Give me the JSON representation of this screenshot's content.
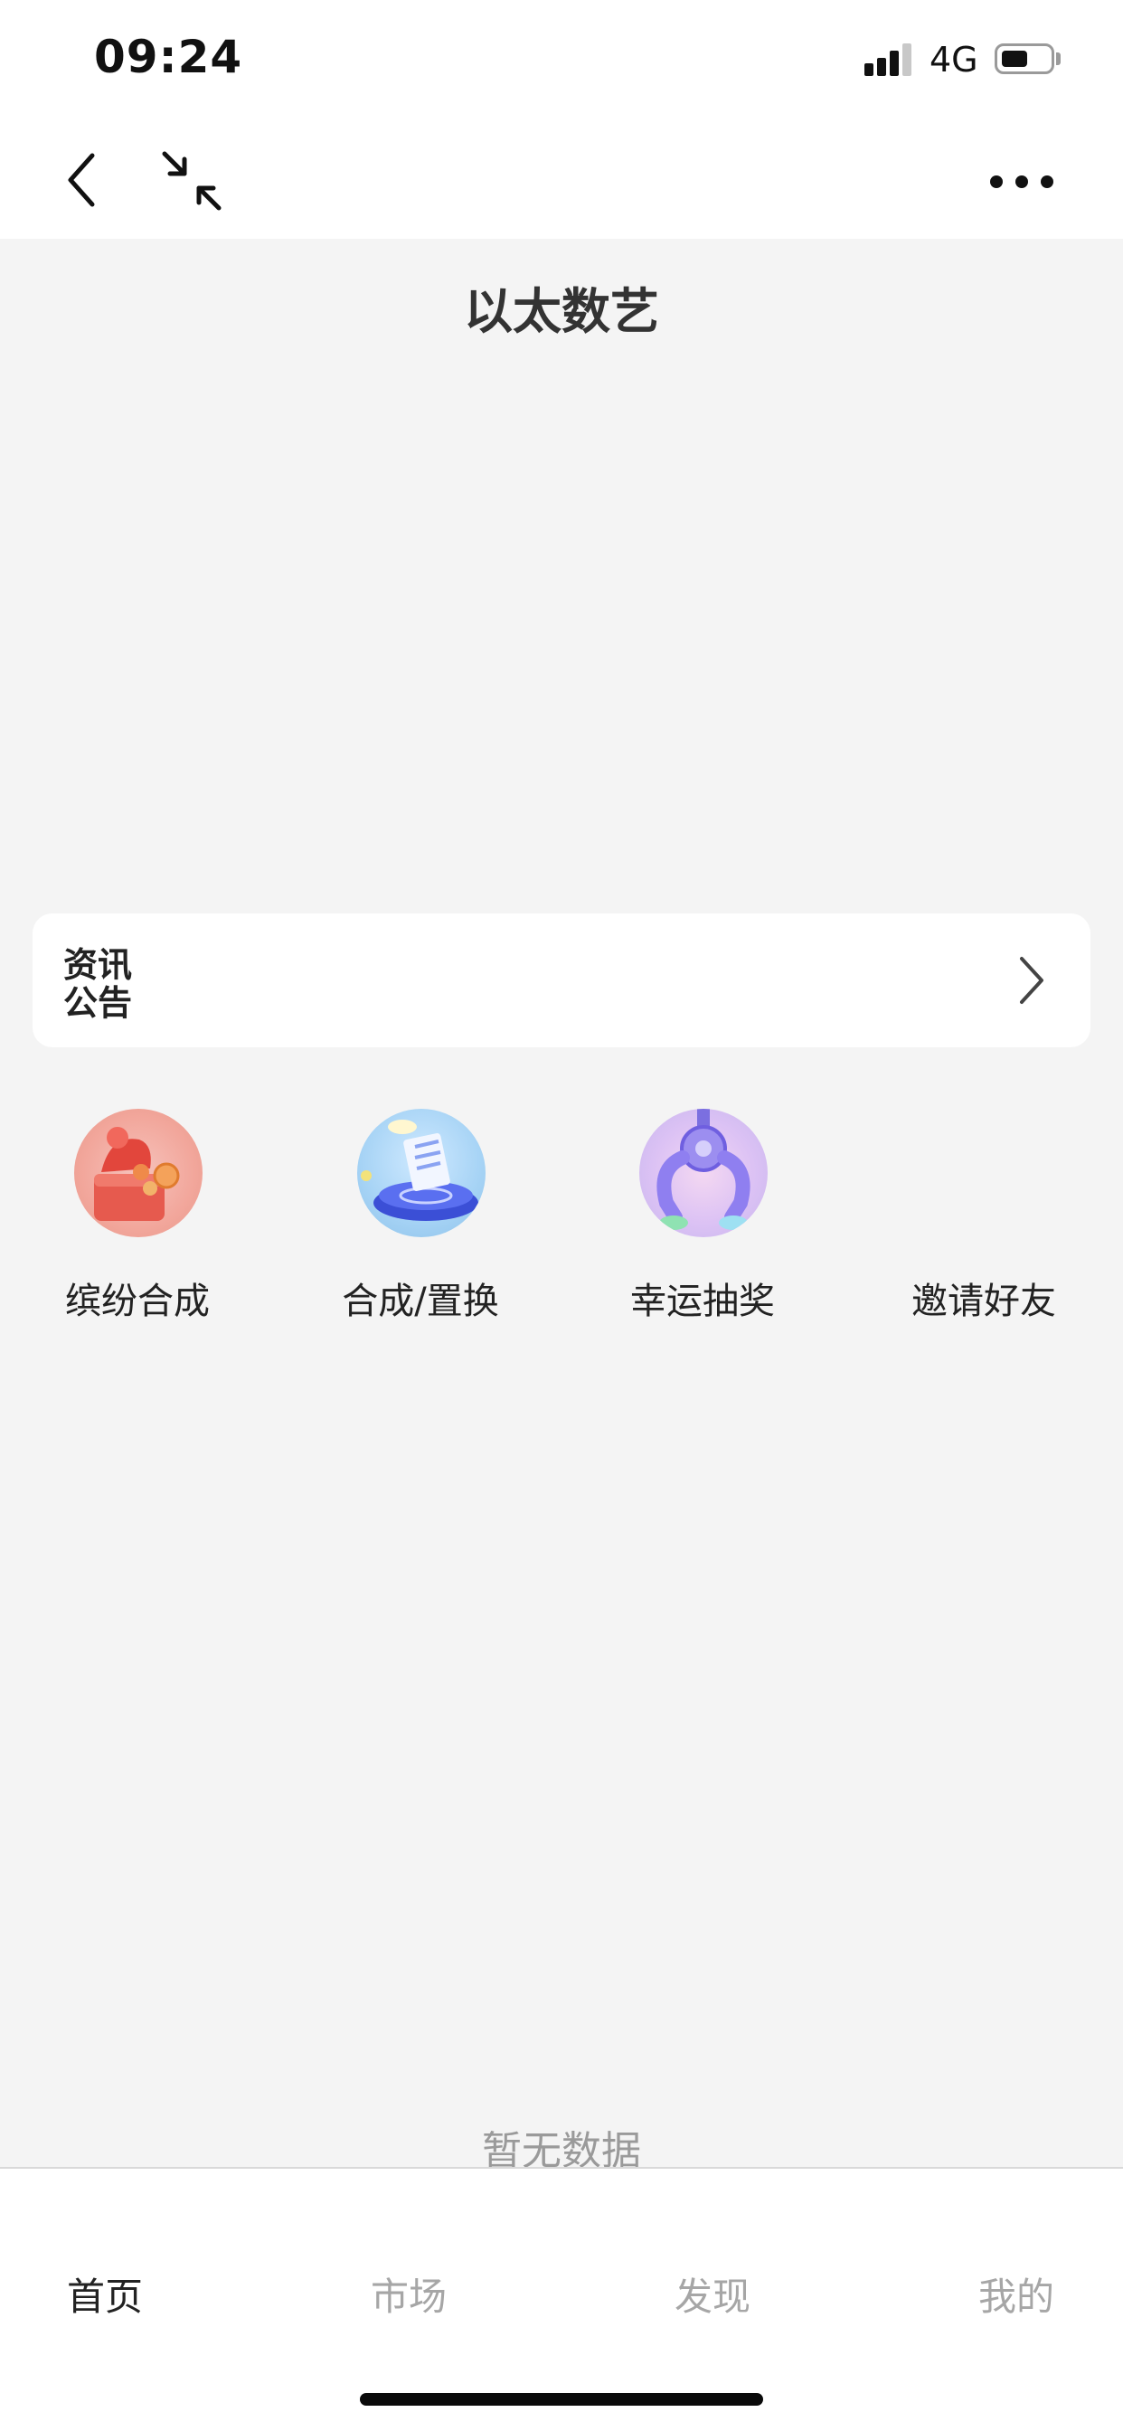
{
  "status_bar": {
    "time": "09:24",
    "network": "4G",
    "battery_level": 0.55
  },
  "nav": {
    "back_icon": "chevron-left-icon",
    "minimize_icon": "minimize-arrows-icon",
    "more_icon": "more-dots-icon"
  },
  "page": {
    "title": "以太数艺"
  },
  "notice": {
    "label_line1": "资讯",
    "label_line2": "公告",
    "arrow_icon": "chevron-right-icon"
  },
  "functions": [
    {
      "label": "缤纷合成",
      "icon": "gift-box-icon"
    },
    {
      "label": "合成/置换",
      "icon": "exchange-platform-icon"
    },
    {
      "label": "幸运抽奖",
      "icon": "claw-machine-icon"
    },
    {
      "label": "邀请好友",
      "icon": "invite-icon"
    }
  ],
  "empty_state": "暂无数据",
  "tabs": [
    {
      "label": "首页",
      "active": true
    },
    {
      "label": "市场",
      "active": false
    },
    {
      "label": "发现",
      "active": false
    },
    {
      "label": "我的",
      "active": false
    }
  ],
  "colors": {
    "background": "#f4f4f4",
    "active_tab": "#222222",
    "inactive_tab": "#a6a6a6"
  }
}
